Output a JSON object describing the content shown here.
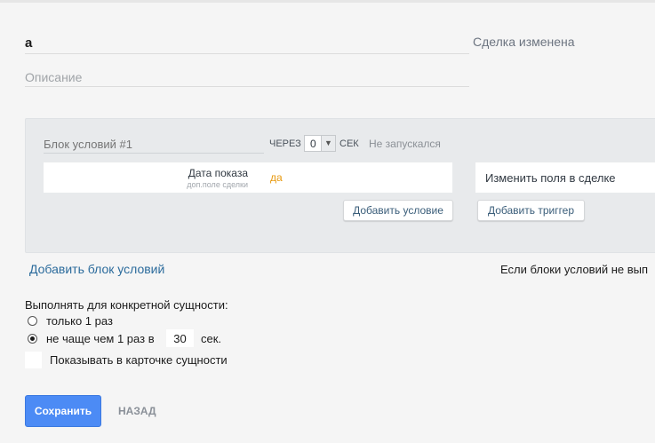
{
  "trigger": {
    "name_value": "а",
    "description_placeholder": "Описание",
    "title": "Сделка изменена"
  },
  "condition_block": {
    "name_placeholder": "Блок условий #1",
    "through_label": "ЧЕРЕЗ",
    "delay_value": "0",
    "sec_label": "СЕК",
    "status": "Не запускался",
    "conditions": [
      {
        "name": "Дата показа",
        "source": "доп.поле сделки",
        "value": "да"
      }
    ],
    "add_condition_label": "Добавить условие",
    "action_label": "Изменить поля в сделке",
    "add_trigger_label": "Добавить триггер"
  },
  "add_block_label": "Добавить блок условий",
  "else_text": "Если блоки условий не вып",
  "execution": {
    "title": "Выполнять для конкретной сущности:",
    "option_once": "только 1 раз",
    "option_freq_prefix": "не чаще чем 1 раз в",
    "freq_value": "30",
    "freq_unit": "сек.",
    "selected": "freq",
    "show_in_card_label": "Показывать в карточке сущности"
  },
  "footer": {
    "save_label": "Сохранить",
    "back_label": "НАЗАД"
  },
  "colors": {
    "accent": "#4c8bf5",
    "link": "#2b6b9c",
    "condition_value": "#e89a10"
  }
}
